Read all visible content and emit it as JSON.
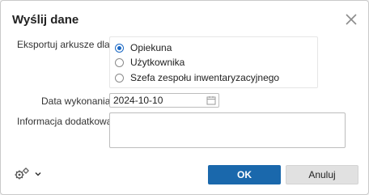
{
  "dialog": {
    "title": "Wyślij dane",
    "close_icon": "close-icon"
  },
  "export": {
    "label": "Eksportuj arkusze dla:",
    "options": [
      {
        "label": "Opiekuna",
        "selected": true
      },
      {
        "label": "Użytkownika",
        "selected": false
      },
      {
        "label": "Szefa zespołu inwentaryzacyjnego",
        "selected": false
      }
    ]
  },
  "date": {
    "label": "Data wykonania",
    "value": "2024-10-10",
    "icon": "calendar-icon"
  },
  "info": {
    "label": "Informacja dodatkowa",
    "value": ""
  },
  "footer": {
    "settings_icon": "gears-icon",
    "dropdown_icon": "chevron-down-icon",
    "ok_label": "OK",
    "cancel_label": "Anuluj"
  },
  "colors": {
    "accent": "#1a68ac",
    "radio_checked": "#1a68c4"
  }
}
